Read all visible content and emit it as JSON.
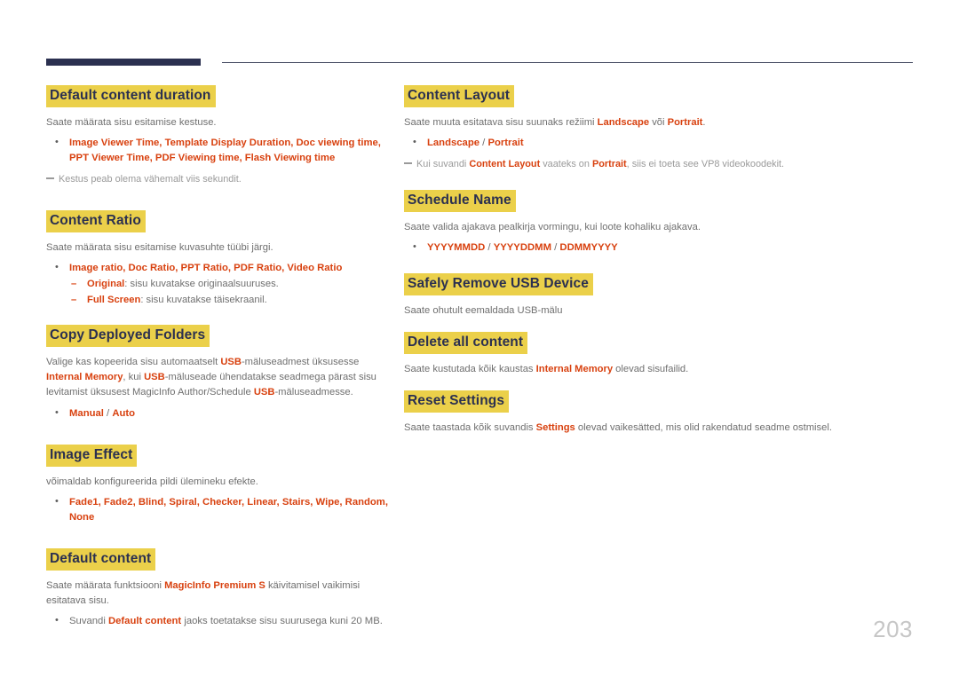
{
  "document": {
    "page_number": "203",
    "colors": {
      "heading_highlight": "#ebd04a",
      "heading_text": "#2b3050",
      "emphasis_text": "#d8410f",
      "body_text": "#6f6f6f",
      "note_text": "#9a9a9a",
      "header_bar": "#2b3050",
      "page_number": "#c6c6c6"
    }
  },
  "left_column": {
    "sections": [
      {
        "heading": "Default content duration",
        "body": "Saate määrata sisu esitamise kestuse.",
        "bullet": {
          "items": "Image Viewer Time, Template Display Duration, Doc viewing time, PPT Viewer Time, PDF Viewing time, Flash Viewing time"
        },
        "note": "Kestus peab olema vähemalt viis sekundit."
      },
      {
        "heading": "Content Ratio",
        "body": "Saate määrata sisu esitamise kuvasuhte tüübi järgi.",
        "bullet": {
          "items": "Image ratio, Doc Ratio, PPT Ratio, PDF Ratio, Video Ratio"
        },
        "sub_items": [
          {
            "term": "Original",
            "desc": ": sisu kuvatakse originaalsuuruses."
          },
          {
            "term": "Full Screen",
            "desc": ": sisu kuvatakse täisekraanil."
          }
        ]
      },
      {
        "heading": "Copy Deployed Folders",
        "body_parts": {
          "p1": "Valige kas kopeerida sisu automaatselt ",
          "e1": "USB",
          "p2": "-mäluseadmest üksusesse ",
          "e2": "Internal Memory",
          "p3": ", kui ",
          "e3": "USB",
          "p4": "-mäluseade ühendatakse seadmega pärast sisu levitamist üksusest MagicInfo Author/Schedule ",
          "e4": "USB",
          "p5": "-mäluseadmesse."
        },
        "bullet": {
          "option_a": "Manual",
          "separator": " / ",
          "option_b": "Auto"
        }
      },
      {
        "heading": "Image Effect",
        "body": "võimaldab konfigureerida pildi ülemineku efekte.",
        "bullet": {
          "items": "Fade1, Fade2, Blind, Spiral, Checker, Linear, Stairs, Wipe, Random, None"
        }
      },
      {
        "heading": "Default content",
        "body_parts": {
          "p1": "Saate määrata funktsiooni ",
          "e1": "MagicInfo Premium S",
          "p2": " käivitamisel vaikimisi esitatava sisu."
        },
        "bullet_parts": {
          "p1": "Suvandi ",
          "e1": "Default content",
          "p2": " jaoks toetatakse sisu suurusega kuni 20 MB."
        }
      }
    ]
  },
  "right_column": {
    "sections": [
      {
        "heading": "Content Layout",
        "body_parts": {
          "p1": "Saate muuta esitatava sisu suunaks režiimi ",
          "e1": "Landscape",
          "p2": " või ",
          "e2": "Portrait",
          "p3": "."
        },
        "bullet": {
          "option_a": "Landscape",
          "separator": " / ",
          "option_b": "Portrait"
        },
        "note_parts": {
          "p1": "Kui suvandi ",
          "e1": "Content Layout",
          "p2": " vaateks on ",
          "e2": "Portrait",
          "p3": ", siis ei toeta see VP8 videokoodekit."
        }
      },
      {
        "heading": "Schedule Name",
        "body": "Saate valida ajakava pealkirja vormingu, kui loote kohaliku ajakava.",
        "bullet": {
          "option_a": "YYYYMMDD",
          "sep1": " / ",
          "option_b": "YYYYDDMM",
          "sep2": " / ",
          "option_c": "DDMMYYYY"
        }
      },
      {
        "heading": "Safely Remove USB Device",
        "body": "Saate ohutult eemaldada USB-mälu"
      },
      {
        "heading": "Delete all content",
        "body_parts": {
          "p1": "Saate kustutada kõik kaustas ",
          "e1": "Internal Memory",
          "p2": " olevad sisufailid."
        }
      },
      {
        "heading": "Reset Settings",
        "body_parts": {
          "p1": "Saate taastada kõik suvandis ",
          "e1": "Settings",
          "p2": " olevad vaikesätted, mis olid rakendatud seadme ostmisel."
        }
      }
    ]
  }
}
